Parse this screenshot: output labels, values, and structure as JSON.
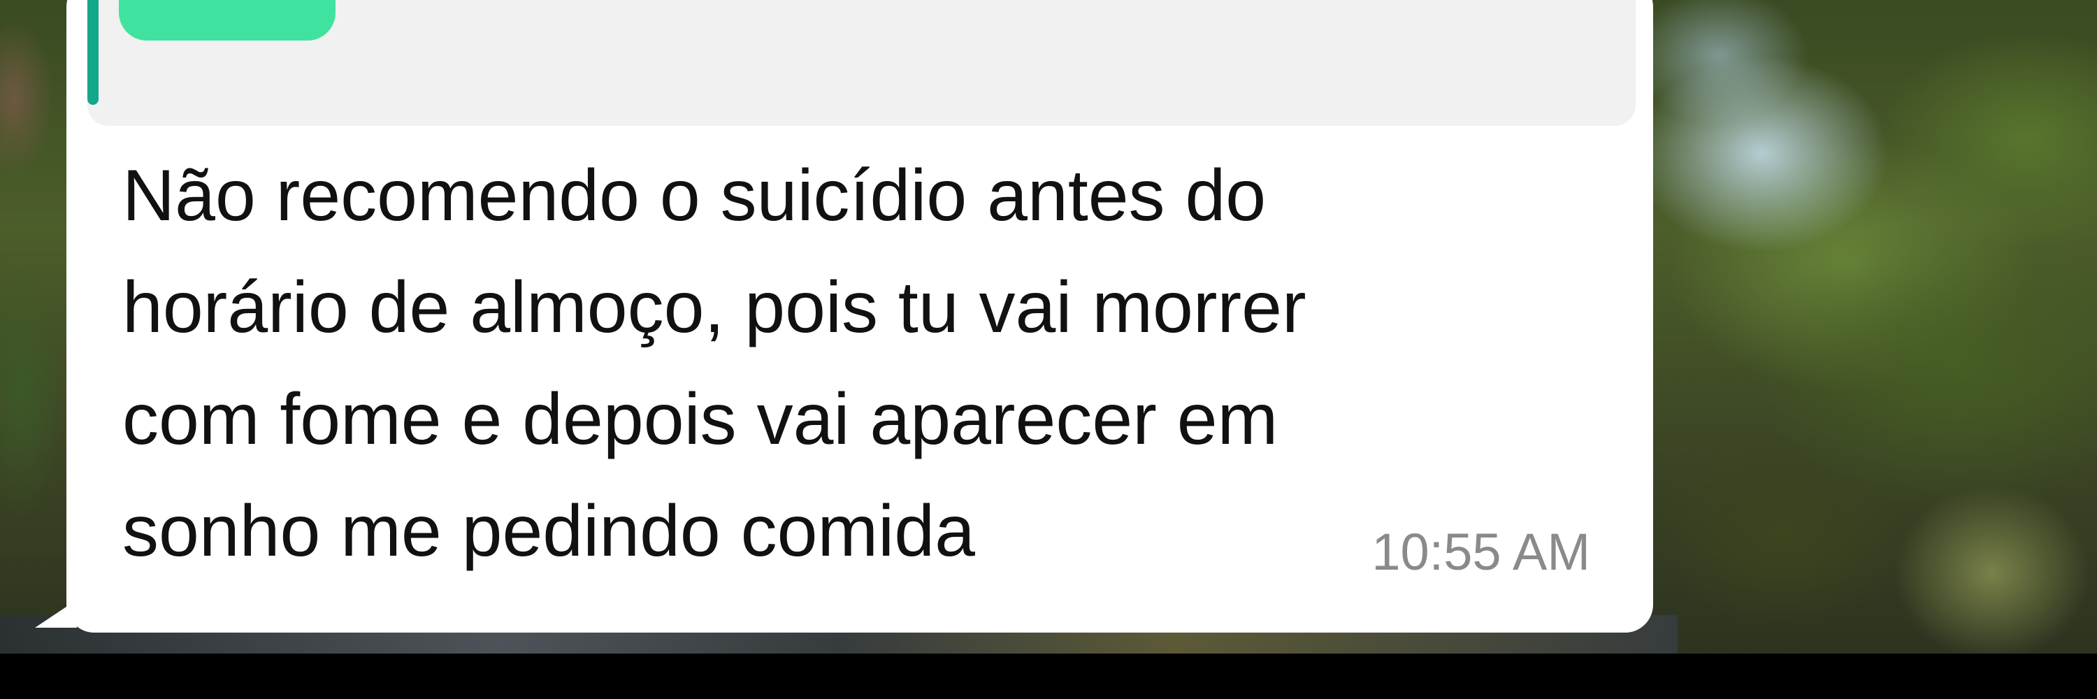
{
  "message": {
    "text": "Não recomendo o suicídio antes do\nhorário de almoço, pois tu vai morrer\ncom fome e depois vai aparecer em\nsonho me pedindo comida",
    "time": "10:55 AM"
  },
  "colors": {
    "bubble_background": "#ffffff",
    "quote_background": "#f1f1f1",
    "quote_accent": "#14a88a",
    "quote_sender_redaction": "#3fe39f",
    "timestamp": "#8a8a8a",
    "bottom_bar": "#000000"
  }
}
